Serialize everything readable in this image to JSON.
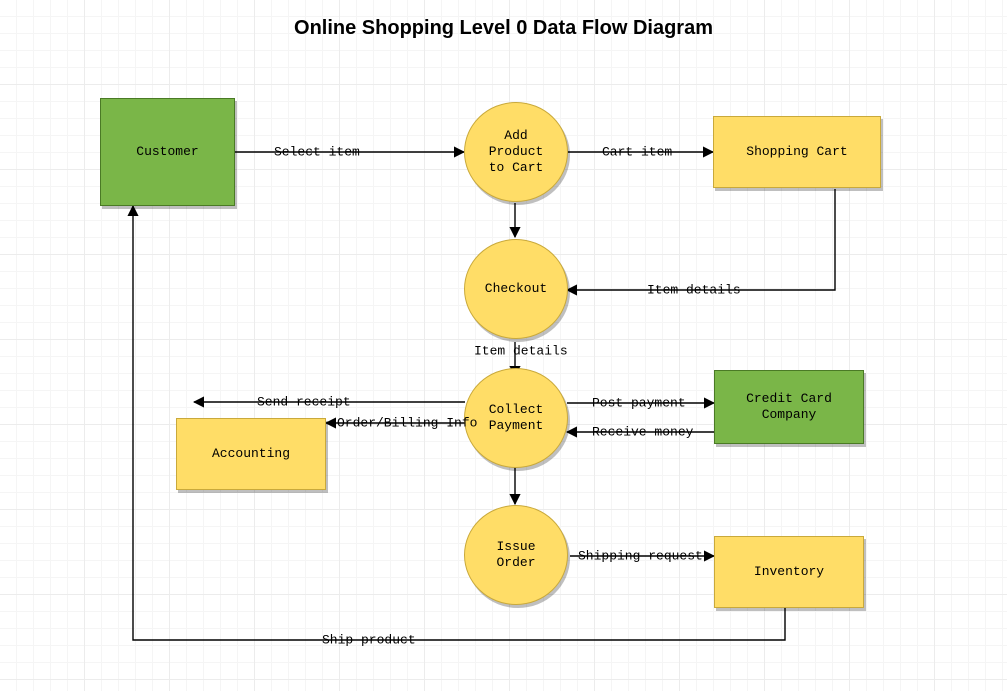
{
  "title": "Online Shopping Level 0 Data Flow Diagram",
  "nodes": {
    "customer": "Customer",
    "addProduct": "Add\nProduct\nto Cart",
    "shoppingCart": "Shopping Cart",
    "checkout": "Checkout",
    "accounting": "Accounting",
    "collect": "Collect\nPayment",
    "creditCard": "Credit Card\nCompany",
    "issueOrder": "Issue\nOrder",
    "inventory": "Inventory"
  },
  "edges": {
    "selectItem": "Select item",
    "cartItem": "Cart item",
    "itemDetailsR": "Item details",
    "itemDetailsV": "Item details",
    "sendReceipt": "Send receipt",
    "orderBilling": "Order/Billing Info",
    "postPayment": "Post payment",
    "receiveMoney": "Receive money",
    "shipRequest": "Shipping request",
    "shipProduct": "Ship product"
  }
}
